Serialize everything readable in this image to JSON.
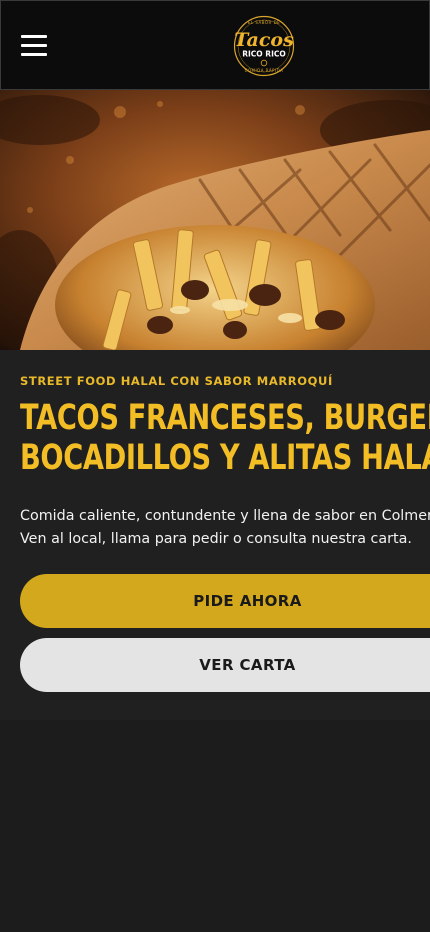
{
  "header": {
    "menu_icon": "hamburger-menu-icon",
    "logo": {
      "top_text": "EL SABOR DE",
      "script_text": "Tacos",
      "bottom_text": "RICO RICO",
      "tagline": "COMIDA RÁPIDA"
    }
  },
  "hero": {
    "image_subject": "grilled french taco filled with fries, meat and melted cheese"
  },
  "main": {
    "eyebrow": "STREET FOOD HALAL CON SABOR MARROQUÍ",
    "title_line1": "TACOS FRANCESES, BURGERS,",
    "title_line2": "BOCADILLOS Y ALITAS HALAL",
    "description_line1": "Comida caliente, contundente y llena de sabor en Colmenar Viejo.",
    "description_line2": "Ven al local, llama para pedir o consulta nuestra carta.",
    "primary_button": "PIDE AHORA",
    "secondary_button": "VER CARTA"
  },
  "colors": {
    "header_bg": "#0c0c0c",
    "accent_yellow": "#f3bd25",
    "button_yellow": "#d3a81c",
    "button_light": "#e4e4e4",
    "panel_bg": "#202020",
    "page_bg": "#1c1c1c"
  }
}
